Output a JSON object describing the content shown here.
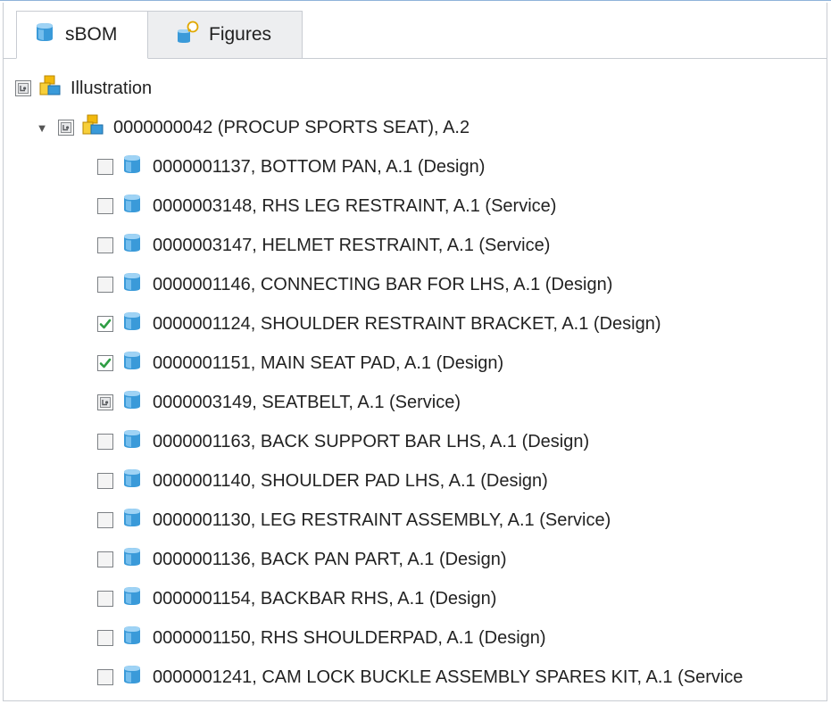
{
  "tabs": [
    {
      "label": "sBOM",
      "icon": "part-cube-icon",
      "active": true
    },
    {
      "label": "Figures",
      "icon": "figures-icon",
      "active": false
    }
  ],
  "tree": {
    "illustration": {
      "label": "Illustration",
      "icon": "assembly-icon",
      "check_state": "partial"
    },
    "root": {
      "label": "0000000042 (PROCUP SPORTS SEAT), A.2",
      "icon": "assembly-icon",
      "check_state": "partial",
      "expanded": true
    },
    "items": [
      {
        "label": "0000001137, BOTTOM PAN, A.1 (Design)",
        "check_state": "unchecked"
      },
      {
        "label": "0000003148, RHS LEG RESTRAINT, A.1 (Service)",
        "check_state": "unchecked"
      },
      {
        "label": "0000003147, HELMET RESTRAINT, A.1 (Service)",
        "check_state": "unchecked"
      },
      {
        "label": "0000001146, CONNECTING BAR FOR LHS, A.1 (Design)",
        "check_state": "unchecked"
      },
      {
        "label": "0000001124, SHOULDER RESTRAINT BRACKET, A.1 (Design)",
        "check_state": "checked"
      },
      {
        "label": "0000001151, MAIN SEAT PAD, A.1 (Design)",
        "check_state": "checked"
      },
      {
        "label": "0000003149, SEATBELT, A.1 (Service)",
        "check_state": "partial"
      },
      {
        "label": "0000001163, BACK SUPPORT BAR LHS, A.1 (Design)",
        "check_state": "unchecked"
      },
      {
        "label": "0000001140, SHOULDER PAD LHS, A.1 (Design)",
        "check_state": "unchecked"
      },
      {
        "label": "0000001130, LEG RESTRAINT ASSEMBLY, A.1 (Service)",
        "check_state": "unchecked"
      },
      {
        "label": "0000001136, BACK PAN PART, A.1 (Design)",
        "check_state": "unchecked"
      },
      {
        "label": "0000001154, BACKBAR RHS, A.1 (Design)",
        "check_state": "unchecked"
      },
      {
        "label": "0000001150, RHS SHOULDERPAD, A.1 (Design)",
        "check_state": "unchecked"
      },
      {
        "label": "0000001241, CAM LOCK BUCKLE ASSEMBLY SPARES KIT, A.1 (Service",
        "check_state": "unchecked"
      }
    ]
  },
  "colors": {
    "accent_blue": "#3a9ad9",
    "check_green": "#2f9e44",
    "assembly_yellow": "#f2b90c"
  }
}
